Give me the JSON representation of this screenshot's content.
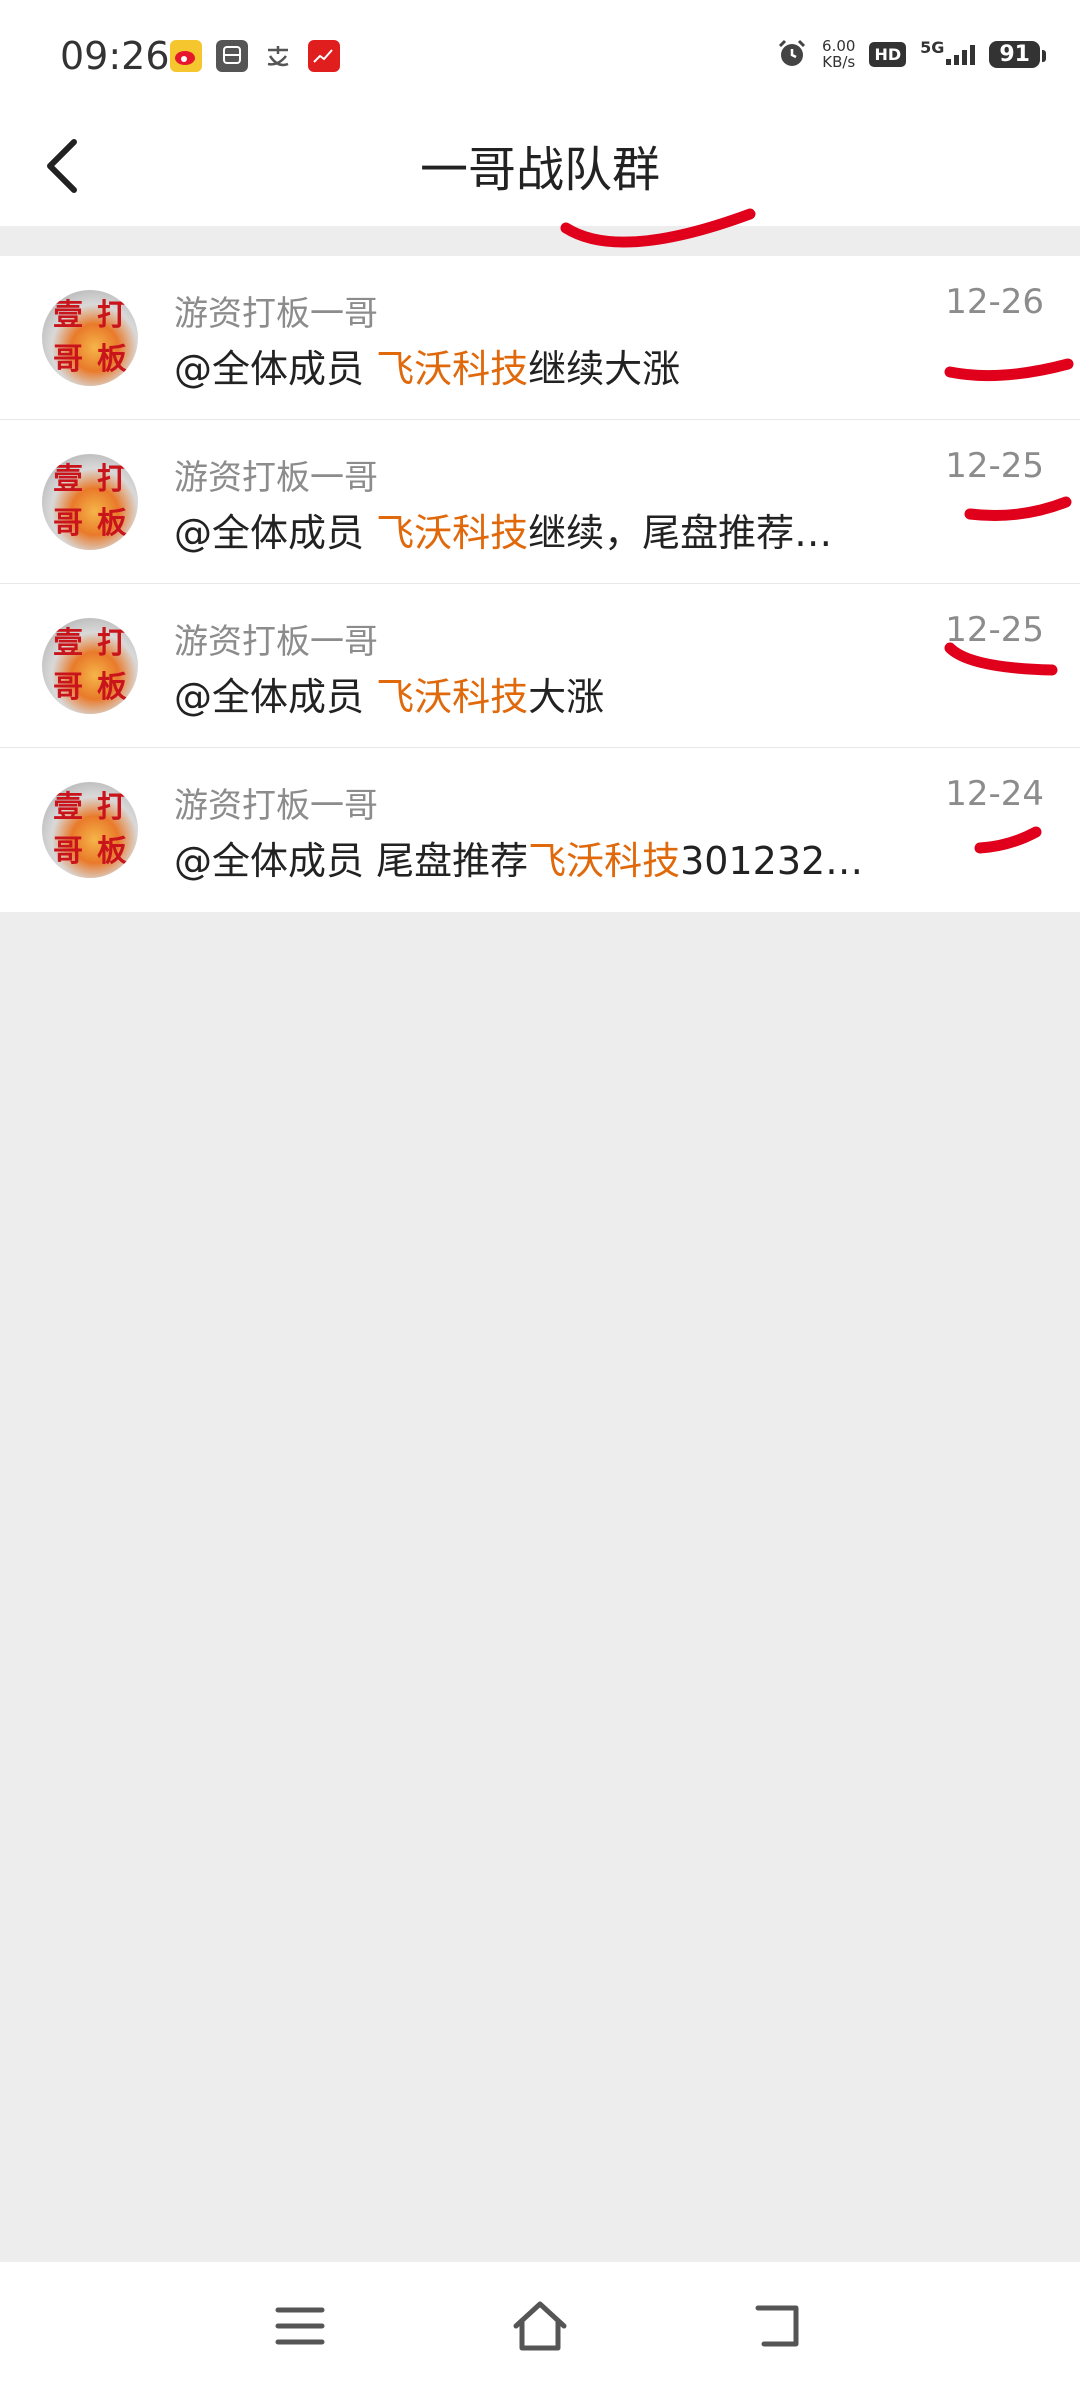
{
  "status": {
    "time": "09:26",
    "net_speed_value": "6.00",
    "net_speed_unit": "KB/s",
    "hd": "HD",
    "network": "5G",
    "battery": "91"
  },
  "header": {
    "title": "一哥战队群"
  },
  "chats": [
    {
      "sender": "游资打板一哥",
      "prefix": "@全体成员 ",
      "highlight": "飞沃科技",
      "suffix": "继续大涨",
      "date": "12-26"
    },
    {
      "sender": "游资打板一哥",
      "prefix": "@全体成员 ",
      "highlight": "飞沃科技",
      "suffix": "继续，尾盘推荐…",
      "date": "12-25"
    },
    {
      "sender": "游资打板一哥",
      "prefix": "@全体成员 ",
      "highlight": "飞沃科技",
      "suffix": "大涨",
      "date": "12-25"
    },
    {
      "sender": "游资打板一哥",
      "prefix": "@全体成员 尾盘推荐",
      "highlight": "飞沃科技",
      "suffix": "301232…",
      "date": "12-24"
    }
  ],
  "avatar_text": [
    "壹",
    "打",
    "哥",
    "板"
  ],
  "colors": {
    "highlight": "#e0690c",
    "annotation": "#e0001b",
    "background": "#ededed"
  },
  "icons": {
    "back": "chevron-left-icon",
    "menu": "menu-icon",
    "home": "home-icon",
    "return": "return-icon"
  }
}
